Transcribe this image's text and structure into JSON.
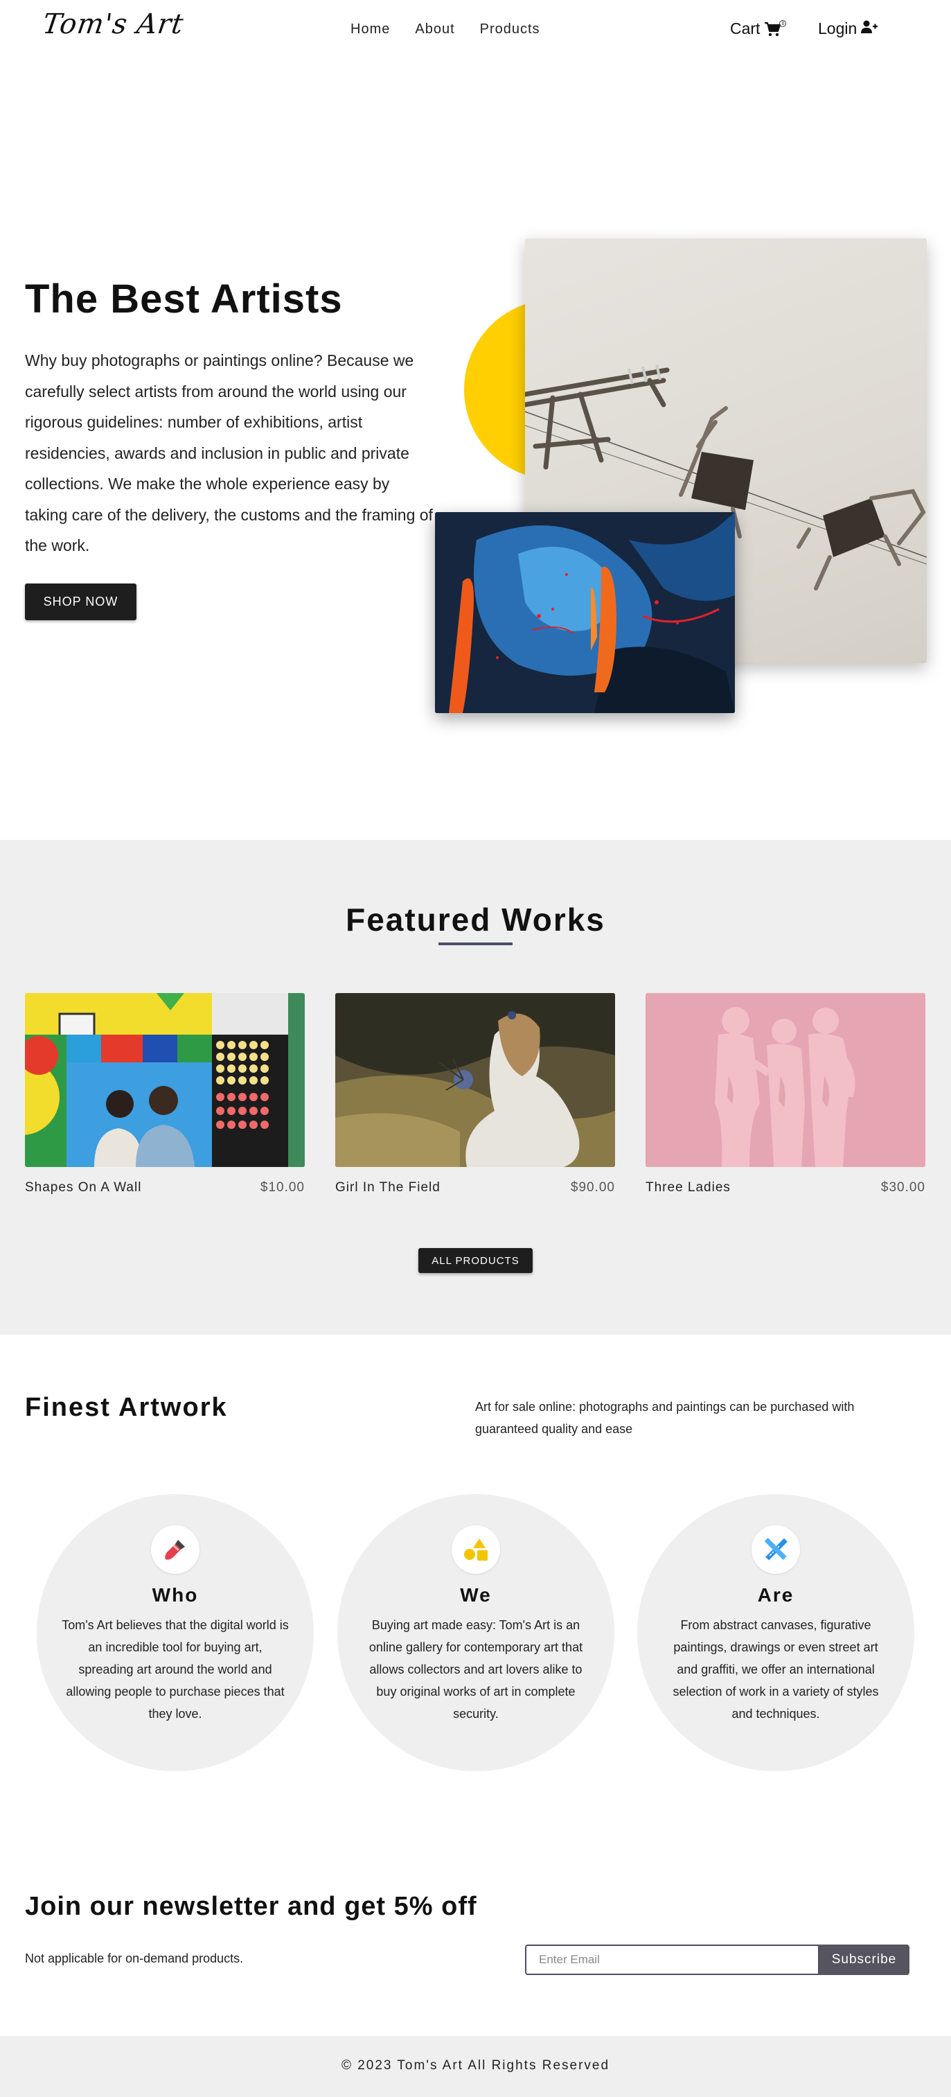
{
  "brand": {
    "logo": "Tom's Art"
  },
  "nav": {
    "links": [
      "Home",
      "About",
      "Products"
    ],
    "cart_label": "Cart",
    "cart_count": "0",
    "login_label": "Login"
  },
  "hero": {
    "title": "The Best Artists",
    "text": "Why buy photographs or paintings online? Because we carefully select artists from around the world using our rigorous guidelines: number of exhibitions, artist residencies, awards and inclusion in public and private collections. We make the whole experience easy by taking care of the delivery, the customs and the framing of the work.",
    "button": "SHOP NOW",
    "accent_color": "#ffcf02"
  },
  "featured": {
    "title": "Featured Works",
    "products": [
      {
        "name": "Shapes On A Wall",
        "price": "$10.00"
      },
      {
        "name": "Girl In The Field",
        "price": "$90.00"
      },
      {
        "name": "Three Ladies",
        "price": "$30.00"
      }
    ],
    "button": "ALL PRODUCTS"
  },
  "finest": {
    "title": "Finest Artwork",
    "text": "Art for sale online: photographs and paintings can be purchased with guaranteed quality and ease",
    "items": [
      {
        "icon": "paintbrush-icon",
        "title": "Who",
        "text": "Tom's Art believes that the digital world is an incredible tool for buying art, spreading art around the world and allowing people to purchase pieces that they love."
      },
      {
        "icon": "shapes-icon",
        "title": "We",
        "text": "Buying art made easy: Tom's Art is an online gallery for contemporary art that allows collectors and art lovers alike to buy original works of art in complete security."
      },
      {
        "icon": "pencil-ruler-icon",
        "title": "Are",
        "text": "From abstract canvases, figurative paintings, drawings or even street art and graffiti, we offer an international selection of work in a variety of styles and techniques."
      }
    ]
  },
  "newsletter": {
    "title": "Join our newsletter and get 5% off",
    "note": "Not applicable for on-demand products.",
    "placeholder": "Enter Email",
    "button": "Subscribe"
  },
  "footer": {
    "text": "© 2023 Tom's Art All Rights Reserved"
  }
}
